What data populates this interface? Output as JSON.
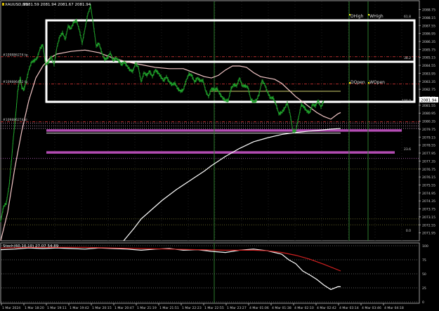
{
  "window": {
    "symbol_header": "XAUUSD,M1",
    "ohlc_header": "2081.59 2081.94 2081.67 2081.94"
  },
  "chart_data": [
    {
      "type": "line",
      "title": "XAUUSD,M1",
      "price_axis": {
        "ticks": [
          "2089.36",
          "2088.75",
          "2088.15",
          "2087.55",
          "2086.95",
          "2086.35",
          "2085.75",
          "2085.15",
          "2084.55",
          "2083.95",
          "2083.35",
          "2082.75",
          "2082.15",
          "2081.55",
          "2080.95",
          "2080.35",
          "2079.75",
          "2079.15",
          "2078.55",
          "2077.95",
          "2077.35",
          "2076.75",
          "2076.15",
          "2075.55",
          "2074.95",
          "2074.35",
          "2073.75",
          "2073.15",
          "2072.55",
          "2071.95",
          "2071.35"
        ],
        "ylim": [
          2071.35,
          2089.36
        ],
        "current_price_label": "2081.94"
      },
      "time_axis": {
        "labels": [
          "1 Mar 2024",
          "1 Mar 18:20",
          "1 Mar 19:11",
          "1 Mar 19:42",
          "1 Mar 20:15",
          "1 Mar 20:47",
          "1 Mar 21:19",
          "1 Mar 21:51",
          "1 Mar 22:23",
          "1 Mar 22:55",
          "1 Mar 23:27",
          "4 Mar 01:06",
          "4 Mar 01:38",
          "4 Mar 02:10",
          "4 Mar 02:42",
          "4 Mar 03:14",
          "4 Mar 03:46",
          "4 Mar 04:18"
        ]
      },
      "horizontal_levels": [
        {
          "label": "#109886274 tp",
          "price": 2085.2,
          "color": "#c83232",
          "style": "dash-dot"
        },
        {
          "label": "#109886412 tp",
          "price": 2083.15,
          "color": "#c83232",
          "style": "dash-dot"
        },
        {
          "label": "#109886274 sl",
          "price": 2080.3,
          "color": "#c83232",
          "style": "dash-dot"
        },
        {
          "label": "",
          "price": 2082.6,
          "color": "#e6e67a",
          "style": "solid"
        },
        {
          "label": "",
          "price": 2081.75,
          "color": "#ffffff",
          "style": "solid"
        },
        {
          "label": "",
          "price": 2079.45,
          "color": "#ffffff",
          "style": "solid"
        },
        {
          "label": "",
          "price": 2080.2,
          "color": "#c8a0c8",
          "style": "dotted"
        },
        {
          "label": "",
          "price": 2080.0,
          "color": "#c8a0c8",
          "style": "dotted"
        },
        {
          "label": "",
          "price": 2079.8,
          "color": "#c8a0c8",
          "style": "dotted"
        },
        {
          "label": "",
          "price": 2077.55,
          "color": "#b060b0",
          "style": "dotted"
        },
        {
          "label": "",
          "price": 2076.75,
          "color": "#6a6a2a",
          "style": "dotted"
        },
        {
          "label": "",
          "price": 2073.0,
          "color": "#6a6a2a",
          "style": "dotted"
        },
        {
          "label": "",
          "price": 2072.55,
          "color": "#6a6a2a",
          "style": "dotted"
        }
      ],
      "zone_lines": [
        {
          "price": 2079.65,
          "color": "#b44cb4"
        },
        {
          "price": 2078.0,
          "color": "#b44cb4"
        }
      ],
      "fib_labels": [
        "61.8",
        "38.2",
        "100.0",
        "23.6",
        "0.0"
      ],
      "session_markers": [
        "DHigh",
        "WHigh",
        "DOpen",
        "WOpen"
      ],
      "price_series": {
        "name": "",
        "x": [
          0,
          4,
          8,
          12,
          14,
          16,
          18,
          20,
          22,
          24,
          26,
          28,
          30,
          33,
          36,
          40,
          44,
          48,
          52,
          56,
          60,
          64,
          68,
          72,
          76,
          80,
          84,
          88,
          92,
          96,
          100,
          104,
          108,
          112,
          116,
          120,
          124,
          128,
          132,
          136,
          140,
          144,
          148,
          152,
          156,
          160,
          164,
          168,
          172,
          176,
          180,
          184,
          188,
          192,
          196,
          200,
          204,
          208,
          212,
          216,
          220,
          224,
          228,
          232,
          236,
          240,
          244,
          248,
          252,
          256,
          260,
          264,
          268,
          272,
          276,
          280,
          284,
          288,
          292,
          296,
          300,
          304,
          308,
          312,
          316,
          320,
          324,
          328,
          332,
          336,
          340,
          344,
          348,
          352,
          356,
          360,
          364,
          368,
          372,
          376,
          380,
          384,
          388,
          392,
          396,
          400,
          404,
          408,
          412,
          416,
          420,
          424,
          428,
          432,
          436,
          440,
          444,
          448,
          452,
          456,
          460,
          464,
          468,
          472,
          476,
          480,
          484
        ],
        "y": [
          2072.8,
          2073.9,
          2074.2,
          2075.5,
          2076.6,
          2077.8,
          2079.1,
          2080.1,
          2081.2,
          2082.5,
          2083.2,
          2083.6,
          2082.9,
          2082.7,
          2083.3,
          2084.2,
          2084.8,
          2084.9,
          2085.1,
          2085.8,
          2086.1,
          2084.6,
          2084.8,
          2085.2,
          2084.6,
          2085.9,
          2086.7,
          2087.0,
          2086.5,
          2087.5,
          2087.3,
          2087.8,
          2087.9,
          2087.2,
          2086.2,
          2087.3,
          2088.4,
          2089.0,
          2087.6,
          2086.0,
          2086.2,
          2085.5,
          2085.0,
          2085.1,
          2085.5,
          2084.9,
          2085.1,
          2084.9,
          2084.6,
          2084.8,
          2084.5,
          2084.2,
          2084.1,
          2084.7,
          2084.4,
          2083.3,
          2084.0,
          2083.8,
          2084.1,
          2083.7,
          2084.2,
          2084.0,
          2083.7,
          2083.4,
          2083.7,
          2083.3,
          2083.1,
          2083.2,
          2082.8,
          2082.6,
          2082.7,
          2083.4,
          2083.9,
          2083.8,
          2083.3,
          2083.6,
          2083.4,
          2083.4,
          2082.6,
          2082.2,
          2082.8,
          2082.7,
          2082.8,
          2082.4,
          2082.1,
          2081.9,
          2081.9,
          2082.8,
          2083.1,
          2083.0,
          2083.6,
          2083.0,
          2083.0,
          2082.9,
          2082.0,
          2081.8,
          2081.9,
          2082.4,
          2083.4,
          2083.1,
          2082.5,
          2082.1,
          2082.1,
          2081.6,
          2080.9,
          2081.0,
          2081.3,
          2081.7,
          2080.9,
          2079.6,
          2079.6,
          2080.6,
          2081.6,
          2081.4,
          2081.1,
          2081.0,
          2081.6,
          2081.5,
          2081.9,
          2081.4,
          2081.9
        ],
        "color": "#1fa02a"
      },
      "ma_series": [
        {
          "name": "",
          "color": "#f5c8c8",
          "x": [
            0,
            10,
            20,
            30,
            40,
            50,
            60,
            70,
            80,
            90,
            100,
            120,
            140,
            160,
            180,
            200,
            220,
            240,
            250,
            260,
            270,
            280,
            290,
            300,
            310,
            320,
            330,
            340,
            350,
            360,
            370,
            380,
            390,
            400,
            410,
            420,
            430,
            440,
            450,
            460,
            470,
            480,
            484
          ],
          "y": [
            2071.35,
            2073.5,
            2076.8,
            2079.6,
            2081.9,
            2083.6,
            2084.5,
            2085.1,
            2085.4,
            2085.5,
            2085.6,
            2085.7,
            2085.5,
            2085.1,
            2084.8,
            2084.6,
            2084.4,
            2084.3,
            2084.3,
            2084.3,
            2084.1,
            2083.9,
            2083.7,
            2083.6,
            2083.8,
            2084.2,
            2084.5,
            2084.5,
            2084.4,
            2084.0,
            2083.7,
            2083.6,
            2083.5,
            2083.2,
            2082.7,
            2082.2,
            2081.8,
            2081.4,
            2081.0,
            2080.7,
            2080.5,
            2080.9,
            2081.0
          ]
        },
        {
          "name": "",
          "color": "#ffffff",
          "x": [
            175,
            190,
            200,
            215,
            230,
            250,
            270,
            290,
            300,
            320,
            340,
            360,
            380,
            400,
            420,
            440,
            460,
            470,
            484
          ],
          "y": [
            2071.35,
            2072.3,
            2073.0,
            2073.7,
            2074.4,
            2075.2,
            2075.9,
            2076.6,
            2077.0,
            2077.7,
            2078.3,
            2078.8,
            2079.1,
            2079.35,
            2079.5,
            2079.6,
            2079.7,
            2079.75,
            2079.8
          ]
        }
      ]
    },
    {
      "type": "line",
      "title": "Stoch(60,10,10)",
      "header": "Stoch(60,10,10) 27.07 54.89",
      "levels": [
        "100",
        "75",
        "50",
        "25",
        "0"
      ],
      "ylim": [
        0,
        100
      ],
      "series": [
        {
          "name": "",
          "color": "#ffffff",
          "x": [
            0,
            20,
            40,
            60,
            80,
            100,
            120,
            140,
            160,
            180,
            200,
            220,
            240,
            260,
            280,
            300,
            320,
            340,
            360,
            380,
            400,
            410,
            420,
            430,
            440,
            450,
            460,
            470,
            480,
            484
          ],
          "y": [
            93,
            94,
            96,
            95,
            96,
            95,
            94,
            96,
            95,
            94,
            92,
            94,
            95,
            92,
            93,
            90,
            88,
            92,
            94,
            91,
            85,
            75,
            68,
            55,
            48,
            40,
            30,
            22,
            27,
            27
          ]
        },
        {
          "name": "",
          "color": "#d02020",
          "x": [
            0,
            40,
            80,
            120,
            160,
            200,
            240,
            280,
            320,
            360,
            380,
            400,
            420,
            440,
            460,
            484
          ],
          "y": [
            96,
            97,
            97,
            97,
            96,
            95,
            94,
            93,
            92,
            92,
            91,
            88,
            83,
            76,
            67,
            55
          ]
        }
      ]
    }
  ]
}
